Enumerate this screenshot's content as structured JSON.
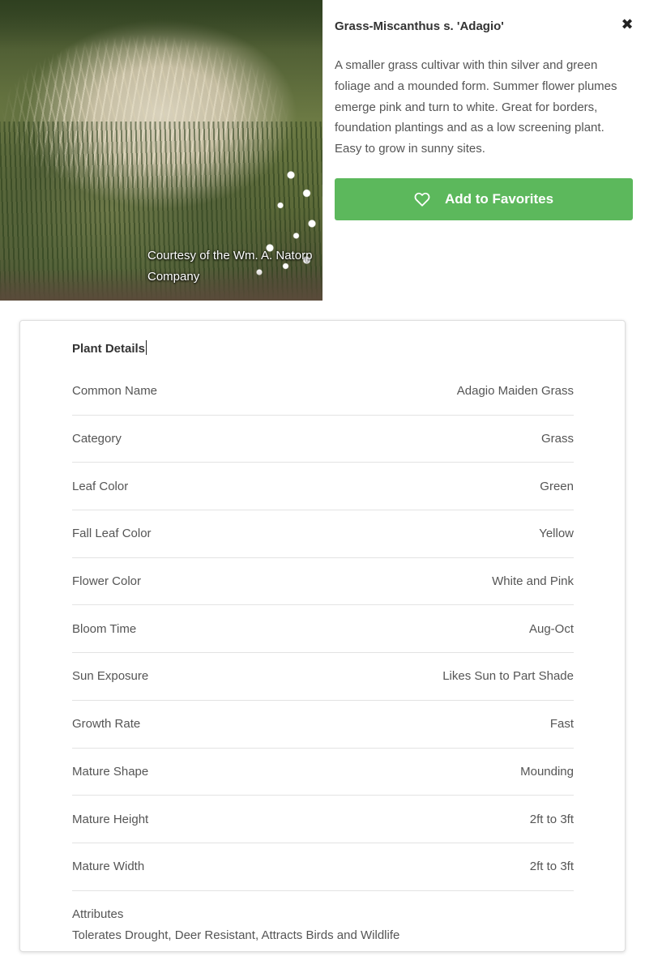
{
  "photo": {
    "credit": "Courtesy of the Wm. A. Natorp Company"
  },
  "plant": {
    "title": "Grass-Miscanthus s. 'Adagio'",
    "description": "A smaller grass cultivar with thin silver and green foliage and a mounded form. Summer flower plumes emerge pink and turn to white. Great for borders, foundation plantings and as a low screening plant. Easy to grow in sunny sites.",
    "close_icon": "close-icon",
    "favorite_label": "Add to Favorites",
    "favorite_icon": "heart-icon",
    "favorite_color": "#5cb85c"
  },
  "details": {
    "title": "Plant Details",
    "rows": [
      {
        "label": "Common Name",
        "value": "Adagio Maiden Grass"
      },
      {
        "label": "Category",
        "value": "Grass"
      },
      {
        "label": "Leaf Color",
        "value": "Green"
      },
      {
        "label": "Fall Leaf Color",
        "value": "Yellow"
      },
      {
        "label": "Flower Color",
        "value": "White and Pink"
      },
      {
        "label": "Bloom Time",
        "value": "Aug-Oct"
      },
      {
        "label": "Sun Exposure",
        "value": "Likes Sun to Part Shade"
      },
      {
        "label": "Growth Rate",
        "value": "Fast"
      },
      {
        "label": "Mature Shape",
        "value": "Mounding"
      },
      {
        "label": "Mature Height",
        "value": "2ft to 3ft"
      },
      {
        "label": "Mature Width",
        "value": "2ft to 3ft"
      }
    ],
    "attributes_label": "Attributes",
    "attributes_value": "Tolerates Drought, Deer Resistant, Attracts Birds and Wildlife"
  }
}
